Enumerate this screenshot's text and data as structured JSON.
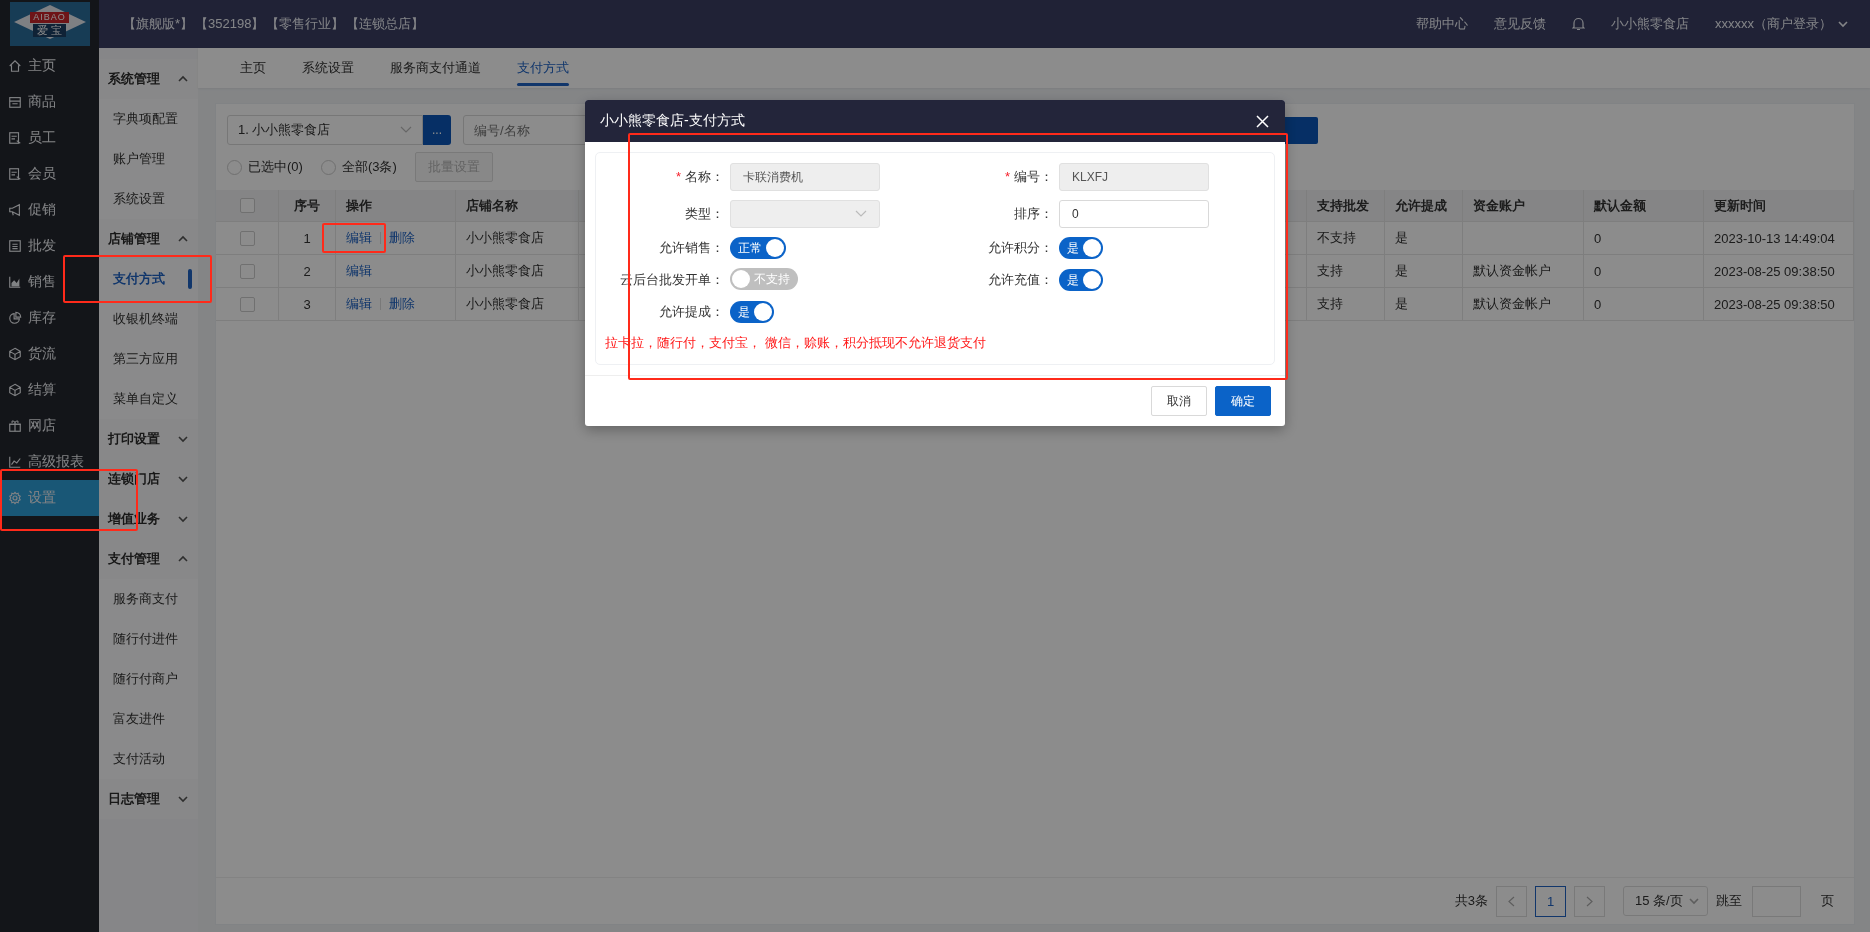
{
  "logo": {
    "brand": "AIBAO",
    "subtitle": "爱 宝"
  },
  "header": {
    "tags": [
      "【旗舰版*】",
      "【352198】",
      "【零售行业】",
      "【连锁总店】"
    ],
    "links": [
      "帮助中心",
      "意见反馈"
    ],
    "store": "小小熊零食店",
    "user": "xxxxxx（商户登录）"
  },
  "nav": [
    {
      "label": "主页",
      "selected": false
    },
    {
      "label": "商品",
      "selected": false
    },
    {
      "label": "员工",
      "selected": false
    },
    {
      "label": "会员",
      "selected": false
    },
    {
      "label": "促销",
      "selected": false
    },
    {
      "label": "批发",
      "selected": false
    },
    {
      "label": "销售",
      "selected": false
    },
    {
      "label": "库存",
      "selected": false
    },
    {
      "label": "货流",
      "selected": false
    },
    {
      "label": "结算",
      "selected": false
    },
    {
      "label": "网店",
      "selected": false
    },
    {
      "label": "高级报表",
      "selected": false
    },
    {
      "label": "设置",
      "selected": true
    }
  ],
  "submenu": [
    {
      "label": "系统管理",
      "expanded": true,
      "children": [
        {
          "label": "字典项配置",
          "selected": false
        },
        {
          "label": "账户管理",
          "selected": false
        },
        {
          "label": "系统设置",
          "selected": false
        }
      ]
    },
    {
      "label": "店铺管理",
      "expanded": true,
      "children": [
        {
          "label": "支付方式",
          "selected": true
        },
        {
          "label": "收银机终端",
          "selected": false
        },
        {
          "label": "第三方应用",
          "selected": false
        },
        {
          "label": "菜单自定义",
          "selected": false
        }
      ]
    },
    {
      "label": "打印设置",
      "expanded": false
    },
    {
      "label": "连锁门店",
      "expanded": false
    },
    {
      "label": "增值业务",
      "expanded": false
    },
    {
      "label": "支付管理",
      "expanded": true,
      "children": [
        {
          "label": "服务商支付",
          "selected": false
        },
        {
          "label": "随行付进件",
          "selected": false
        },
        {
          "label": "随行付商户",
          "selected": false
        },
        {
          "label": "富友进件",
          "selected": false
        },
        {
          "label": "支付活动",
          "selected": false
        }
      ]
    },
    {
      "label": "日志管理",
      "expanded": false
    }
  ],
  "tabs": [
    {
      "label": "主页",
      "selected": false
    },
    {
      "label": "系统设置",
      "selected": false
    },
    {
      "label": "服务商支付通道",
      "selected": false
    },
    {
      "label": "支付方式",
      "selected": true
    }
  ],
  "filter": {
    "store_select": "1. 小小熊零食店",
    "more_button": "...",
    "search_placeholder": "编号/名称",
    "radios": [
      {
        "label": "已选中(0)",
        "selected": false
      },
      {
        "label": "全部(3条)",
        "selected": false
      }
    ],
    "batch_button": "批量设置"
  },
  "table": {
    "select_all_checked": false,
    "columns_left": [
      "序号",
      "操作",
      "店铺名称"
    ],
    "columns_right": [
      "支持批发",
      "允许提成",
      "资金账户",
      "默认金额",
      "更新时间"
    ],
    "rows": [
      {
        "checked": false,
        "index": "1",
        "actions": [
          "编辑",
          "删除"
        ],
        "store": "小小熊零食店",
        "wholesale": "不支持",
        "commission": "是",
        "default_amount": "0",
        "updated": "2023-10-13 14:49:04"
      },
      {
        "checked": false,
        "index": "2",
        "actions": [
          "编辑"
        ],
        "store": "小小熊零食店",
        "wholesale": "支持",
        "commission": "是",
        "account": "默认资金帐户",
        "default_amount": "0",
        "updated": "2023-08-25 09:38:50"
      },
      {
        "checked": false,
        "index": "3",
        "actions": [
          "编辑",
          "删除"
        ],
        "store": "小小熊零食店",
        "wholesale": "支持",
        "commission": "是",
        "account": "默认资金帐户",
        "default_amount": "0",
        "updated": "2023-08-25 09:38:50"
      }
    ]
  },
  "pagination": {
    "total": "共3条",
    "current": "1",
    "page_size": "15 条/页",
    "jump_label": "跳至",
    "page_suffix": "页"
  },
  "dialog": {
    "title": "小小熊零食店-支付方式",
    "fields": [
      {
        "kind": "input",
        "marker": "*",
        "label": "名称：",
        "value": "卡联消费机",
        "disabled": true
      },
      {
        "kind": "input",
        "marker": "*",
        "label": "编号：",
        "value": "KLXFJ",
        "disabled": true
      },
      {
        "kind": "select",
        "label": "类型：",
        "disabled": true
      },
      {
        "kind": "input",
        "label": "排序：",
        "value": "0",
        "disabled": false
      },
      {
        "kind": "switch",
        "label": "允许销售：",
        "on": true,
        "text": "正常"
      },
      {
        "kind": "switch",
        "label": "允许积分：",
        "on": true,
        "text": "是"
      },
      {
        "kind": "switch",
        "label": "云后台批发开单：",
        "on": false,
        "text": "不支持"
      },
      {
        "kind": "switch",
        "label": "允许充值：",
        "on": true,
        "text": "是"
      },
      {
        "kind": "switch",
        "label": "允许提成：",
        "on": true,
        "text": "是"
      }
    ],
    "note": "拉卡拉，随行付，支付宝， 微信，赊账，积分抵现不允许退货支付",
    "buttons": [
      {
        "label": "取消",
        "primary": false
      },
      {
        "label": "确定",
        "primary": true
      }
    ]
  },
  "annotations": [
    {
      "kind": "edit_link"
    },
    {
      "kind": "submenu_item"
    },
    {
      "kind": "nav_item"
    },
    {
      "kind": "dialog"
    }
  ]
}
